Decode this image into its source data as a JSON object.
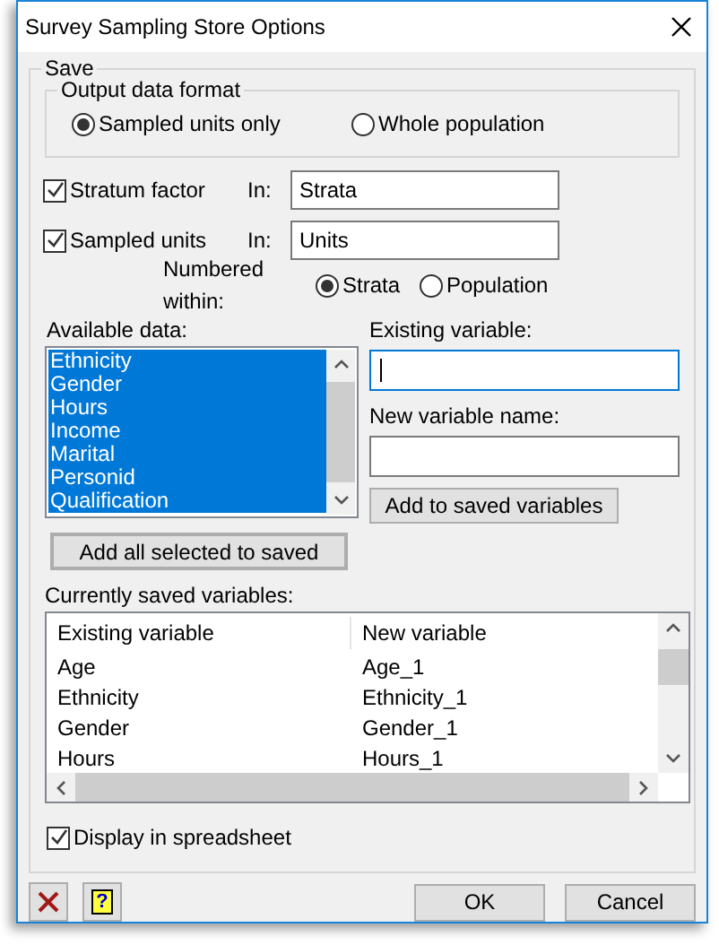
{
  "window": {
    "title": "Survey Sampling Store Options"
  },
  "save_group": {
    "title": "Save"
  },
  "output_format": {
    "title": "Output data format",
    "options": [
      {
        "label": "Sampled units only",
        "selected": true
      },
      {
        "label": "Whole population",
        "selected": false
      }
    ]
  },
  "store_rows": [
    {
      "label": "Stratum factor",
      "checked": true,
      "in_label": "In:",
      "value": "Strata"
    },
    {
      "label": "Sampled units",
      "checked": true,
      "in_label": "In:",
      "value": "Units"
    }
  ],
  "numbered_within": {
    "label": "Numbered within:",
    "options": [
      {
        "label": "Strata",
        "selected": true
      },
      {
        "label": "Population",
        "selected": false
      }
    ]
  },
  "available_data": {
    "label": "Available data:",
    "items": [
      {
        "label": "Ethnicity",
        "selected": true
      },
      {
        "label": "Gender",
        "selected": true
      },
      {
        "label": "Hours",
        "selected": true
      },
      {
        "label": "Income",
        "selected": true
      },
      {
        "label": "Marital",
        "selected": true
      },
      {
        "label": "Personid",
        "selected": true
      },
      {
        "label": "Qualification",
        "selected": true
      }
    ]
  },
  "existing_variable": {
    "label": "Existing variable:"
  },
  "new_variable": {
    "label": "New variable name:"
  },
  "add_button": "Add to saved variables",
  "add_all_button": "Add all selected to saved",
  "saved_variables": {
    "label": "Currently saved variables:",
    "columns": [
      "Existing variable",
      "New variable"
    ],
    "rows": [
      [
        "Age",
        "Age_1"
      ],
      [
        "Ethnicity",
        "Ethnicity_1"
      ],
      [
        "Gender",
        "Gender_1"
      ],
      [
        "Hours",
        "Hours_1"
      ]
    ]
  },
  "display_in_spreadsheet": {
    "label": "Display in spreadsheet",
    "checked": true
  },
  "buttons": {
    "ok": "OK",
    "cancel": "Cancel",
    "help": "?"
  }
}
